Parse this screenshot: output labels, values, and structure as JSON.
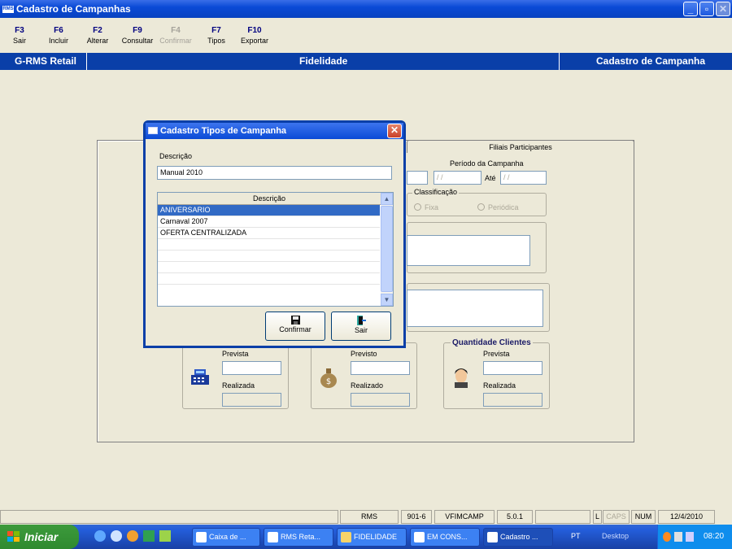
{
  "window": {
    "title": "Cadastro de Campanhas",
    "icon_label": "RMS"
  },
  "toolbar": {
    "items": [
      {
        "key": "F3",
        "label": "Sair",
        "enabled": true
      },
      {
        "key": "F6",
        "label": "Incluir",
        "enabled": true
      },
      {
        "key": "F2",
        "label": "Alterar",
        "enabled": true
      },
      {
        "key": "F9",
        "label": "Consultar",
        "enabled": true
      },
      {
        "key": "F4",
        "label": "Confirmar",
        "enabled": false
      },
      {
        "key": "F7",
        "label": "Tipos",
        "enabled": true
      },
      {
        "key": "F10",
        "label": "Exportar",
        "enabled": true
      }
    ]
  },
  "header": {
    "left": "G-RMS Retail",
    "center": "Fidelidade",
    "right": "Cadastro de Campanha"
  },
  "main": {
    "tab_filiais": "Filiais Participantes",
    "periodo_label": "Período da Campanha",
    "date_from_placeholder": "/ /",
    "ate_label": "Até",
    "date_to_placeholder": "/ /",
    "classificacao_label": "Classificação",
    "radio_fixa": "Fixa",
    "radio_periodica": "Periódica",
    "group_quantidade_clientes": "Quantidade Clientes",
    "label_prevista_1": "Prevista",
    "label_realizada_1": "Realizada",
    "label_previsto_2": "Previsto",
    "label_realizado_2": "Realizado",
    "label_prevista_3": "Prevista",
    "label_realizada_3": "Realizada"
  },
  "dialog": {
    "title": "Cadastro Tipos de Campanha",
    "descricao_label": "Descrição",
    "descricao_value": "Manual 2010",
    "list_header": "Descrição",
    "rows": [
      "ANIVERSARIO",
      "Carnaval 2007",
      "OFERTA CENTRALIZADA"
    ],
    "selected_index": 0,
    "confirm_label": "Confirmar",
    "exit_label": "Sair"
  },
  "statusbar": {
    "app": "RMS",
    "code": "901-6",
    "screen": "VFIMCAMP",
    "version": "5.0.1",
    "l": "L",
    "caps": "CAPS",
    "num": "NUM",
    "date": "12/4/2010"
  },
  "taskbar": {
    "start": "Iniciar",
    "items": [
      "Caixa de ...",
      "RMS Reta...",
      "FIDELIDADE",
      "EM CONS...",
      "Cadastro ..."
    ],
    "lang": "PT",
    "desktop": "Desktop",
    "time": "08:20"
  },
  "colors": {
    "accent": "#0a3fa8",
    "selection": "#316ac5",
    "window_bg": "#ece9d8"
  }
}
